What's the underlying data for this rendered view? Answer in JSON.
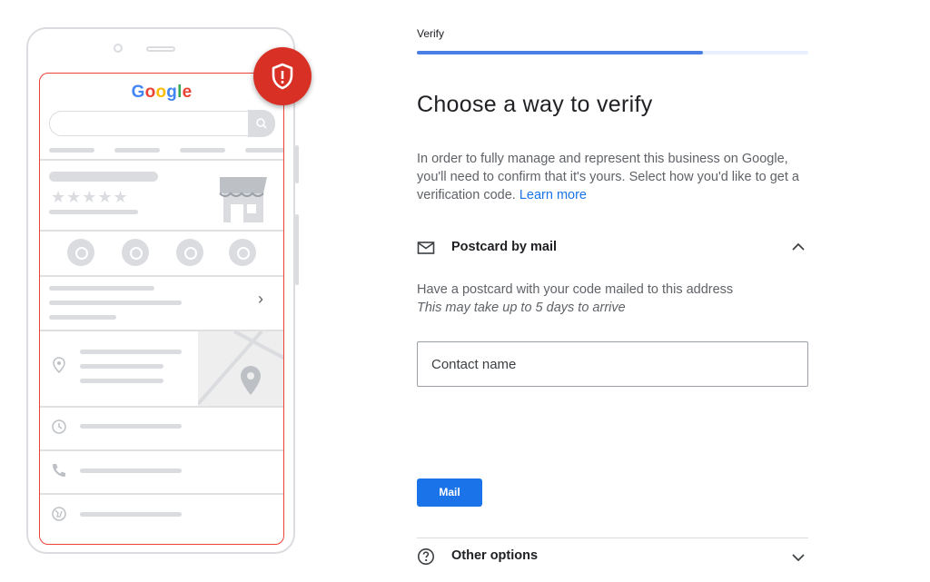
{
  "illustration": {
    "brand": [
      "G",
      "o",
      "o",
      "g",
      "l",
      "e"
    ],
    "brand_colors": [
      "#4285f4",
      "#ea4335",
      "#fbbc05",
      "#4285f4",
      "#34a853",
      "#ea4335"
    ],
    "stars": "★★★★★",
    "chevron": "›",
    "badge_icon": "shield-alert-icon",
    "badge_color": "#d93025"
  },
  "header": {
    "step_label": "Verify",
    "progress_percent": 73
  },
  "main": {
    "title": "Choose a way to verify",
    "description": "In order to fully manage and represent this business on Google, you'll need to confirm that it's yours. Select how you'd like to get a verification code.",
    "learn_more": "Learn more"
  },
  "postcard": {
    "label": "Postcard by mail",
    "icon": "mail-icon",
    "expanded": true,
    "description": "Have a postcard with your code mailed to this address",
    "note": "This may take up to 5 days to arrive",
    "contact_placeholder": "Contact name",
    "contact_value": "",
    "submit_label": "Mail"
  },
  "other_options": {
    "label": "Other options",
    "icon": "help-icon",
    "expanded": false
  },
  "colors": {
    "accent": "#1a73e8",
    "progress": "#4a80e3",
    "outline_red": "#ea4335"
  }
}
